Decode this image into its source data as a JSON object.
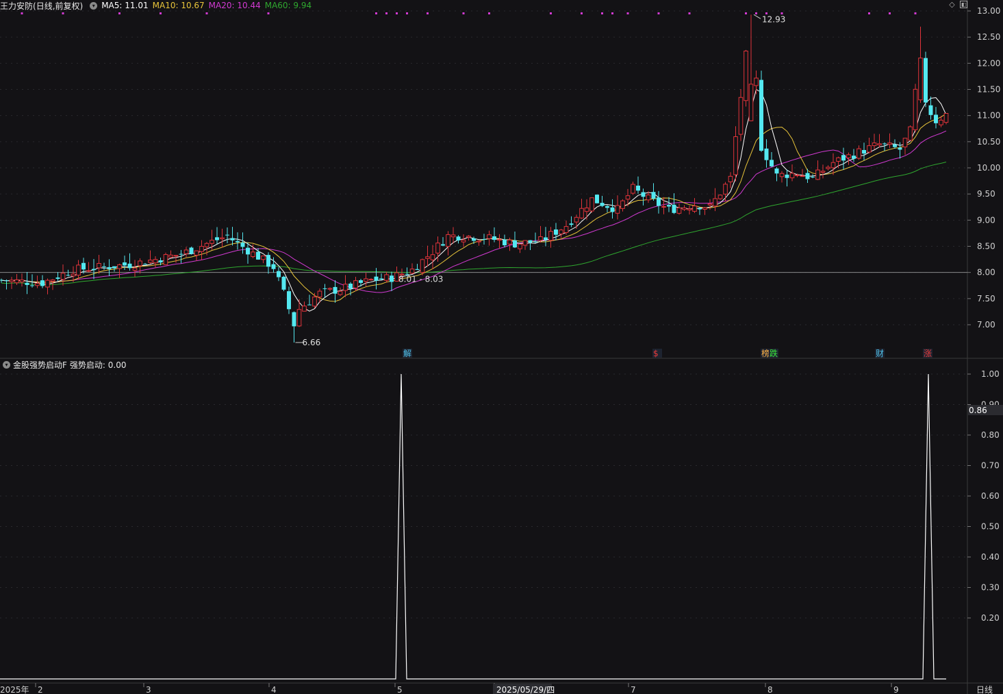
{
  "header": {
    "stock_name": "王力安防",
    "mode": "(日线,前复权)",
    "ma5": "MA5: 11.01",
    "ma10": "MA10: 10.67",
    "ma20": "MA20: 10.44",
    "ma60": "MA60: 9.94",
    "colors": {
      "ma5": "#ffffff",
      "ma10": "#e8c43a",
      "ma20": "#d23ad2",
      "ma60": "#2fa82f"
    }
  },
  "price_axis": {
    "ticks": [
      "13.00",
      "12.50",
      "12.00",
      "11.50",
      "11.00",
      "10.50",
      "10.00",
      "9.50",
      "9.00",
      "8.50",
      "8.00",
      "7.50",
      "7.00"
    ],
    "range": [
      6.55,
      13.12
    ]
  },
  "annotations": {
    "high": "12.93",
    "low": "6.66",
    "ref_line": "8.01 - 8.03"
  },
  "event_badges": [
    {
      "label": "解",
      "color": "#4fc1e9"
    },
    {
      "label": "$",
      "color": "#e83a3a"
    },
    {
      "label": "榜",
      "color": "#ffb347"
    },
    {
      "label": "跌",
      "color": "#3ae83a"
    },
    {
      "label": "财",
      "color": "#4fc1e9"
    },
    {
      "label": "涨",
      "color": "#e83a3a"
    }
  ],
  "indicator": {
    "name": "金股强势启动F",
    "value_label": "强势启动: 0.00",
    "ticks": [
      "1.00",
      "0.90",
      "0.80",
      "0.70",
      "0.60",
      "0.50",
      "0.40",
      "0.30",
      "0.20"
    ],
    "current": "0.86",
    "spikes": [
      {
        "from": "2025-05-05",
        "peak": 1.0
      },
      {
        "from": "2025-09-03",
        "peak": 1.0
      }
    ]
  },
  "time_axis": {
    "labels": [
      "2025年",
      "2",
      "3",
      "4",
      "5",
      "2025/05/29/四",
      "7",
      "8",
      "9"
    ],
    "period": "日线"
  },
  "chart_data": {
    "type": "candlestick",
    "title": "王力安防 (日线,前复权)",
    "ylim": [
      6.55,
      13.12
    ],
    "series": [
      {
        "name": "MA5",
        "value": 11.01
      },
      {
        "name": "MA10",
        "value": 10.67
      },
      {
        "name": "MA20",
        "value": 10.44
      },
      {
        "name": "MA60",
        "value": 9.94
      }
    ],
    "high": 12.93,
    "low": 6.66,
    "last_close": 11.02
  }
}
